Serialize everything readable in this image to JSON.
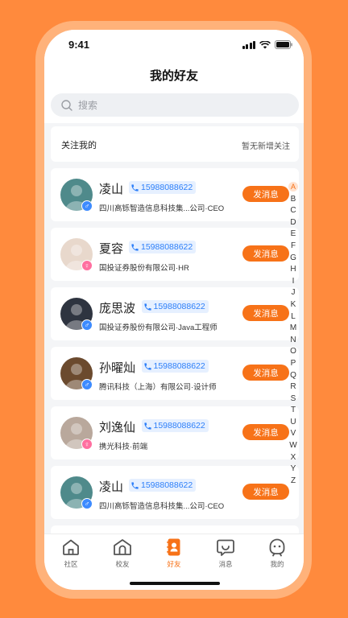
{
  "status_bar": {
    "time": "9:41"
  },
  "header": {
    "title": "我的好友"
  },
  "search": {
    "placeholder": "搜索"
  },
  "follow": {
    "title": "关注我的",
    "status": "暂无新增关注"
  },
  "friends": [
    {
      "name": "凌山",
      "phone": "15988088622",
      "desc": "四川高铄智造信息科技集...公司·CEO",
      "gender": "male",
      "avatar_color": "#4F8A8B",
      "action": "发消息"
    },
    {
      "name": "夏容",
      "phone": "15988088622",
      "desc": "国投证券股份有限公司·HR",
      "gender": "female",
      "avatar_color": "#E8D8CC",
      "action": "发消息"
    },
    {
      "name": "庞思波",
      "phone": "15988088622",
      "desc": "国投证券股份有限公司·Java工程师",
      "gender": "male",
      "avatar_color": "#2E3440",
      "action": "发消息"
    },
    {
      "name": "孙曜灿",
      "phone": "15988088622",
      "desc": "腾讯科技（上海）有限公司·设计师",
      "gender": "male",
      "avatar_color": "#6B4A2E",
      "action": "发消息"
    },
    {
      "name": "刘逸仙",
      "phone": "15988088622",
      "desc": "携光科技·前端",
      "gender": "female",
      "avatar_color": "#B9A89C",
      "action": "发消息"
    },
    {
      "name": "凌山",
      "phone": "15988088622",
      "desc": "四川高铄智造信息科技集...公司·CEO",
      "gender": "male",
      "avatar_color": "#4F8A8B",
      "action": "发消息"
    }
  ],
  "alphabet": [
    "A",
    "B",
    "C",
    "D",
    "E",
    "F",
    "G",
    "H",
    "I",
    "J",
    "K",
    "L",
    "M",
    "N",
    "O",
    "P",
    "Q",
    "R",
    "S",
    "T",
    "U",
    "V",
    "W",
    "X",
    "Y",
    "Z"
  ],
  "tabs": [
    {
      "label": "社区",
      "icon": "home-icon"
    },
    {
      "label": "校友",
      "icon": "school-icon"
    },
    {
      "label": "好友",
      "icon": "friends-book-icon",
      "active": true
    },
    {
      "label": "消息",
      "icon": "message-icon"
    },
    {
      "label": "我的",
      "icon": "profile-icon"
    }
  ],
  "colors": {
    "accent": "#F77218",
    "phone_blue": "#2D7FF9",
    "background": "#FF8A3D"
  }
}
